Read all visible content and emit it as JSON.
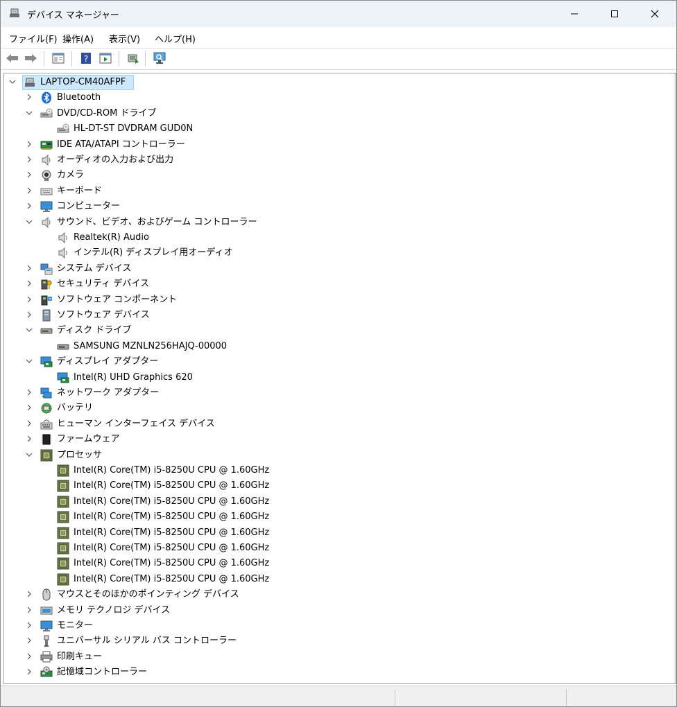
{
  "window": {
    "title": "デバイス マネージャー",
    "icon": "device-manager-icon",
    "controls": [
      "minimize-icon",
      "maximize-icon",
      "close-icon"
    ]
  },
  "menu": [
    "ファイル(F)",
    "操作(A)",
    "表示(V)",
    "ヘルプ(H)"
  ],
  "toolbar": [
    "back-arrow-icon",
    "forward-arrow-icon",
    "properties-pane-icon",
    "help-icon",
    "action-pane-icon",
    "update-driver-icon",
    "scan-hardware-icon"
  ],
  "tree": {
    "root": "LAPTOP-CM40AFPF",
    "categories": [
      {
        "label": "Bluetooth",
        "icon": "bluetooth-icon",
        "expanded": false,
        "children": []
      },
      {
        "label": "DVD/CD-ROM ドライブ",
        "icon": "dvd-drive-icon",
        "expanded": true,
        "children": [
          {
            "label": "HL-DT-ST DVDRAM GUD0N",
            "icon": "dvd-drive-icon"
          }
        ]
      },
      {
        "label": "IDE ATA/ATAPI コントローラー",
        "icon": "ide-controller-icon",
        "expanded": false,
        "children": []
      },
      {
        "label": "オーディオの入力および出力",
        "icon": "speaker-icon",
        "expanded": false,
        "children": []
      },
      {
        "label": "カメラ",
        "icon": "camera-icon",
        "expanded": false,
        "children": []
      },
      {
        "label": "キーボード",
        "icon": "keyboard-icon",
        "expanded": false,
        "children": []
      },
      {
        "label": "コンピューター",
        "icon": "monitor-icon",
        "expanded": false,
        "children": []
      },
      {
        "label": "サウンド、ビデオ、およびゲーム コントローラー",
        "icon": "speaker-icon",
        "expanded": true,
        "children": [
          {
            "label": "Realtek(R) Audio",
            "icon": "speaker-icon"
          },
          {
            "label": "インテル(R) ディスプレイ用オーディオ",
            "icon": "speaker-icon"
          }
        ]
      },
      {
        "label": "システム デバイス",
        "icon": "system-device-icon",
        "expanded": false,
        "children": []
      },
      {
        "label": "セキュリティ デバイス",
        "icon": "security-key-icon",
        "expanded": false,
        "children": []
      },
      {
        "label": "ソフトウェア コンポーネント",
        "icon": "software-component-icon",
        "expanded": false,
        "children": []
      },
      {
        "label": "ソフトウェア デバイス",
        "icon": "software-device-icon",
        "expanded": false,
        "children": []
      },
      {
        "label": "ディスク ドライブ",
        "icon": "disk-drive-icon",
        "expanded": true,
        "children": [
          {
            "label": "SAMSUNG MZNLN256HAJQ-00000",
            "icon": "disk-drive-icon"
          }
        ]
      },
      {
        "label": "ディスプレイ アダプター",
        "icon": "display-adapter-icon",
        "expanded": true,
        "children": [
          {
            "label": "Intel(R) UHD Graphics 620",
            "icon": "display-adapter-icon"
          }
        ]
      },
      {
        "label": "ネットワーク アダプター",
        "icon": "network-adapter-icon",
        "expanded": false,
        "children": []
      },
      {
        "label": "バッテリ",
        "icon": "battery-icon",
        "expanded": false,
        "children": []
      },
      {
        "label": "ヒューマン インターフェイス デバイス",
        "icon": "hid-icon",
        "expanded": false,
        "children": []
      },
      {
        "label": "ファームウェア",
        "icon": "firmware-chip-icon",
        "expanded": false,
        "children": []
      },
      {
        "label": "プロセッサ",
        "icon": "processor-icon",
        "expanded": true,
        "children": [
          {
            "label": "Intel(R) Core(TM) i5-8250U CPU @ 1.60GHz",
            "icon": "processor-icon"
          },
          {
            "label": "Intel(R) Core(TM) i5-8250U CPU @ 1.60GHz",
            "icon": "processor-icon"
          },
          {
            "label": "Intel(R) Core(TM) i5-8250U CPU @ 1.60GHz",
            "icon": "processor-icon"
          },
          {
            "label": "Intel(R) Core(TM) i5-8250U CPU @ 1.60GHz",
            "icon": "processor-icon"
          },
          {
            "label": "Intel(R) Core(TM) i5-8250U CPU @ 1.60GHz",
            "icon": "processor-icon"
          },
          {
            "label": "Intel(R) Core(TM) i5-8250U CPU @ 1.60GHz",
            "icon": "processor-icon"
          },
          {
            "label": "Intel(R) Core(TM) i5-8250U CPU @ 1.60GHz",
            "icon": "processor-icon"
          },
          {
            "label": "Intel(R) Core(TM) i5-8250U CPU @ 1.60GHz",
            "icon": "processor-icon"
          }
        ]
      },
      {
        "label": "マウスとそのほかのポインティング デバイス",
        "icon": "mouse-icon",
        "expanded": false,
        "children": []
      },
      {
        "label": "メモリ テクノロジ デバイス",
        "icon": "memory-technology-icon",
        "expanded": false,
        "children": []
      },
      {
        "label": "モニター",
        "icon": "monitor-icon",
        "expanded": false,
        "children": []
      },
      {
        "label": "ユニバーサル シリアル バス コントローラー",
        "icon": "usb-icon",
        "expanded": false,
        "children": []
      },
      {
        "label": "印刷キュー",
        "icon": "printer-icon",
        "expanded": false,
        "children": []
      },
      {
        "label": "記憶域コントローラー",
        "icon": "storage-controller-icon",
        "expanded": false,
        "children": []
      }
    ]
  },
  "colors": {
    "selection": "#cce8ff",
    "selection_border": "#99d1ff",
    "titlebar": "#eef3f8",
    "accent": "#0063b1"
  }
}
